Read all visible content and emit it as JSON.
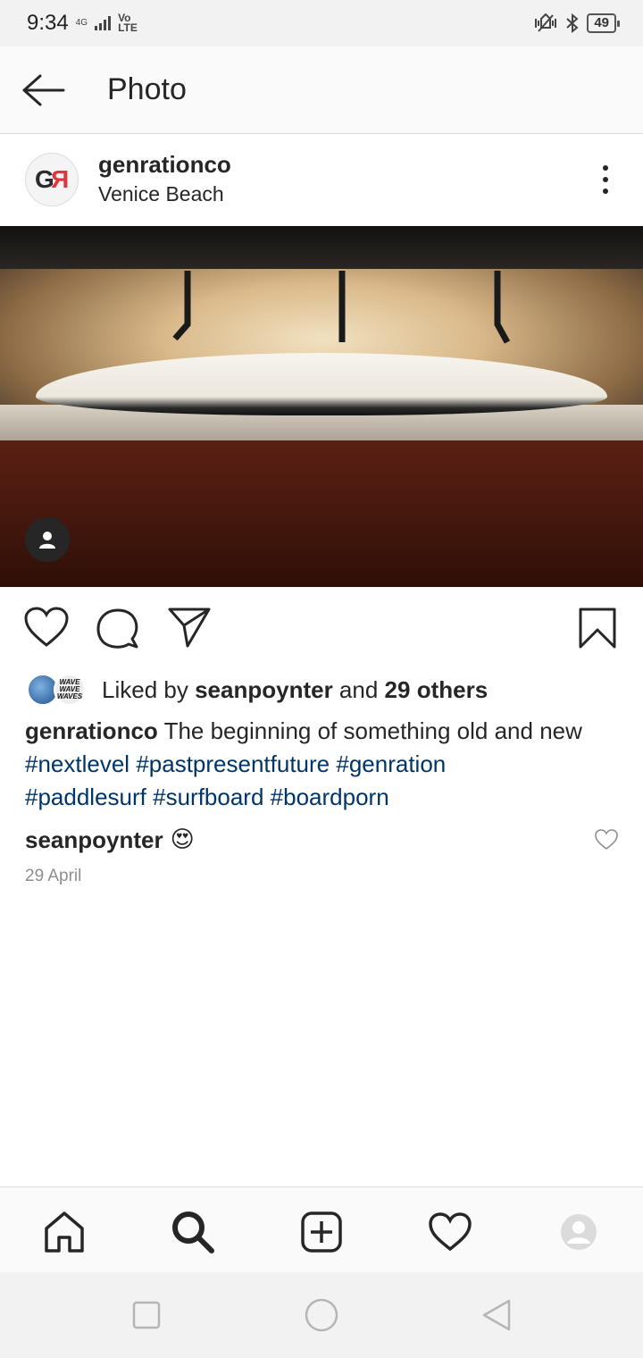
{
  "status_bar": {
    "time": "9:34",
    "signal_label": "4G",
    "volte_top": "Vo",
    "volte_bottom": "LTE",
    "battery": "49"
  },
  "header": {
    "title": "Photo",
    "back_icon": "arrow-left-icon"
  },
  "post": {
    "avatar_left": "G",
    "avatar_right": "R",
    "username": "genrationco",
    "location": "Venice Beach",
    "more_icon": "more-vertical-icon"
  },
  "photo": {
    "tag_icon": "person-tag-icon"
  },
  "actions": {
    "like_icon": "heart-icon",
    "comment_icon": "comment-icon",
    "share_icon": "send-icon",
    "save_icon": "bookmark-icon"
  },
  "likes": {
    "prefix": "Liked by",
    "user": "seanpoynter",
    "conjunction": "and",
    "others": "29 others",
    "liker_badge_text": "WAVE WAVE WAVES"
  },
  "caption": {
    "user": "genrationco",
    "text": "The beginning of something old and new",
    "hashtags": [
      "#nextlevel",
      "#pastpresentfuture",
      "#genration",
      "#paddlesurf",
      "#surfboard",
      "#boardporn"
    ]
  },
  "comment": {
    "user": "seanpoynter",
    "emoji": "😍"
  },
  "date": "29 April",
  "colors": {
    "hashtag": "#003569",
    "text": "#262626",
    "muted": "#8e8e8e",
    "brand_red": "#e0353c"
  },
  "bottom_nav": {
    "items": [
      "home-icon",
      "search-icon",
      "new-post-icon",
      "activity-heart-icon",
      "profile-icon"
    ]
  }
}
